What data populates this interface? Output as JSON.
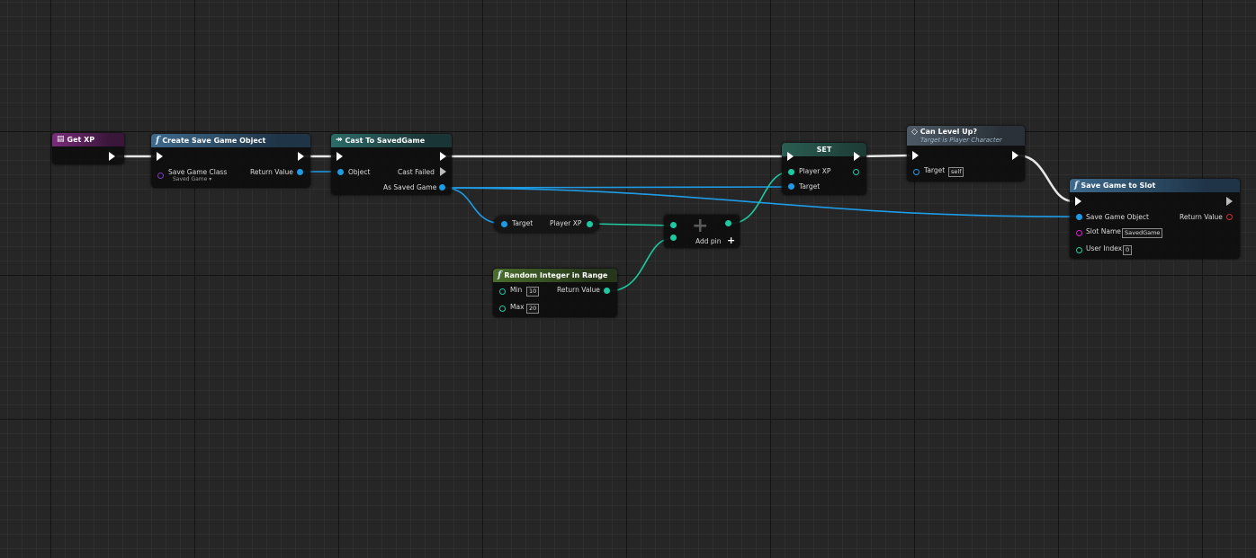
{
  "nodes": {
    "get_xp": {
      "title": "Get XP"
    },
    "create_save": {
      "title": "Create Save Game Object",
      "save_game_class": "Save Game Class",
      "class_value": "Saved Game ▾",
      "return_value": "Return Value"
    },
    "cast": {
      "title": "Cast To SavedGame",
      "object": "Object",
      "cast_failed": "Cast Failed",
      "as_saved_game": "As Saved Game"
    },
    "getter": {
      "target": "Target",
      "player_xp": "Player XP"
    },
    "random": {
      "title": "Random Integer in Range",
      "min": "Min",
      "min_value": "10",
      "max": "Max",
      "max_value": "20",
      "return_value": "Return Value"
    },
    "add": {
      "symbol": "+",
      "add_pin": "Add pin",
      "add_pin_icon": "+"
    },
    "set": {
      "title": "SET",
      "player_xp": "Player XP",
      "target": "Target"
    },
    "can_level": {
      "title": "Can Level Up?",
      "subtitle": "Target is Player Character",
      "target": "Target",
      "target_value": "self"
    },
    "save_slot": {
      "title": "Save Game to Slot",
      "save_game_object": "Save Game Object",
      "return_value": "Return Value",
      "slot_name": "Slot Name",
      "slot_value": "SavedGame",
      "user_index": "User Index",
      "user_index_value": "0"
    }
  },
  "colors": {
    "exec": "#ffffff",
    "object": "#1e9be5",
    "integer": "#1ec9a2",
    "string": "#e01fd0",
    "class": "#7a3db8",
    "bool": "#d12b2b"
  }
}
